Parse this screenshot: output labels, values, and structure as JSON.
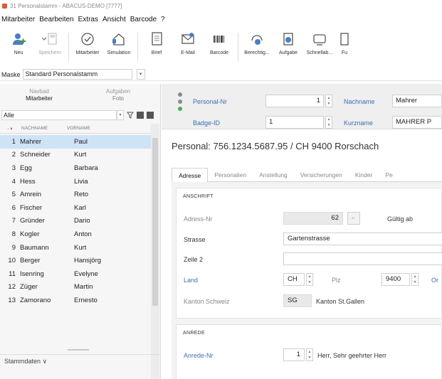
{
  "window": {
    "title": "31 Personalstamm - ABACUS-DEMO [7777]"
  },
  "menu": [
    "Mitarbeiter",
    "Bearbeiten",
    "Extras",
    "Ansicht",
    "Barcode",
    "?"
  ],
  "toolbar": [
    {
      "label": "Neu",
      "icon": "new-person-icon",
      "enabled": true
    },
    {
      "label": "Speichern",
      "icon": "save-icon",
      "enabled": false
    },
    {
      "label": "Mitarbeiter",
      "icon": "check-circle-icon",
      "enabled": true
    },
    {
      "label": "Simulation",
      "icon": "simulation-icon",
      "enabled": true
    },
    {
      "label": "Brief",
      "icon": "letter-icon",
      "enabled": true
    },
    {
      "label": "E-Mail",
      "icon": "email-icon",
      "enabled": true
    },
    {
      "label": "Barcode",
      "icon": "barcode-icon",
      "enabled": true
    },
    {
      "label": "Berechtig...",
      "icon": "permission-icon",
      "enabled": true
    },
    {
      "label": "Aufgabe",
      "icon": "task-icon",
      "enabled": true
    },
    {
      "label": "Schnellab...",
      "icon": "quick-icon",
      "enabled": true
    },
    {
      "label": "Fu",
      "icon": "more-icon",
      "enabled": true
    }
  ],
  "mask": {
    "label": "Maske",
    "value": "Standard Personalstamm"
  },
  "left": {
    "tabs": [
      {
        "sub": "Navbad",
        "label": "Mitarbeiter"
      },
      {
        "sub": "Aufgaben",
        "label": "Foto"
      }
    ],
    "filter": "Alle",
    "columns": [
      "NACHNAME",
      "VORNAME"
    ],
    "rows": [
      {
        "n": "1",
        "last": "Mahrer",
        "first": "Paul"
      },
      {
        "n": "2",
        "last": "Schneider",
        "first": "Kurt"
      },
      {
        "n": "3",
        "last": "Egg",
        "first": "Barbara"
      },
      {
        "n": "4",
        "last": "Hess",
        "first": "Livia"
      },
      {
        "n": "5",
        "last": "Amrein",
        "first": "Reto"
      },
      {
        "n": "6",
        "last": "Fischer",
        "first": "Karl"
      },
      {
        "n": "7",
        "last": "Gründer",
        "first": "Dario"
      },
      {
        "n": "8",
        "last": "Kogler",
        "first": "Anton"
      },
      {
        "n": "9",
        "last": "Baumann",
        "first": "Kurt"
      },
      {
        "n": "10",
        "last": "Berger",
        "first": "Hansjörg"
      },
      {
        "n": "11",
        "last": "Isenring",
        "first": "Evelyne"
      },
      {
        "n": "12",
        "last": "Züger",
        "first": "Martin"
      },
      {
        "n": "13",
        "last": "Zamorano",
        "first": "Ernesto"
      }
    ],
    "stammdaten": "Stammdaten ∨"
  },
  "header": {
    "personal_nr_label": "Personal-Nr",
    "personal_nr": "1",
    "nachname_label": "Nachname",
    "nachname": "Mahrer",
    "badge_label": "Badge-ID",
    "badge": "1",
    "kurzname_label": "Kurzname",
    "kurzname": "MAHRER P"
  },
  "summary": "Personal: 756.1234.5687.95 / CH 9400 Rorschach",
  "tabs": [
    "Adresse",
    "Personalien",
    "Anstellung",
    "Versicherungen",
    "Kinder",
    "Pe"
  ],
  "anschrift": {
    "title": "ANSCHRIFT",
    "adress_nr_label": "Adress-Nr",
    "adress_nr": "62",
    "gueltig_label": "Gültig ab",
    "strasse_label": "Strasse",
    "strasse": "Gartenstrasse",
    "zeile2_label": "Zeile 2",
    "zeile2": "",
    "land_label": "Land",
    "land": "CH",
    "plz_label": "Plz",
    "plz": "9400",
    "ort_label": "Or",
    "kanton_label": "Kanton Schweiz",
    "kanton": "SG",
    "kanton_name": "Kanton St.Gallen"
  },
  "anrede": {
    "title": "ANREDE",
    "anrede_nr_label": "Anrede-Nr",
    "anrede_nr": "1",
    "anrede_text": "Herr, Sehr geehrter Herr"
  }
}
